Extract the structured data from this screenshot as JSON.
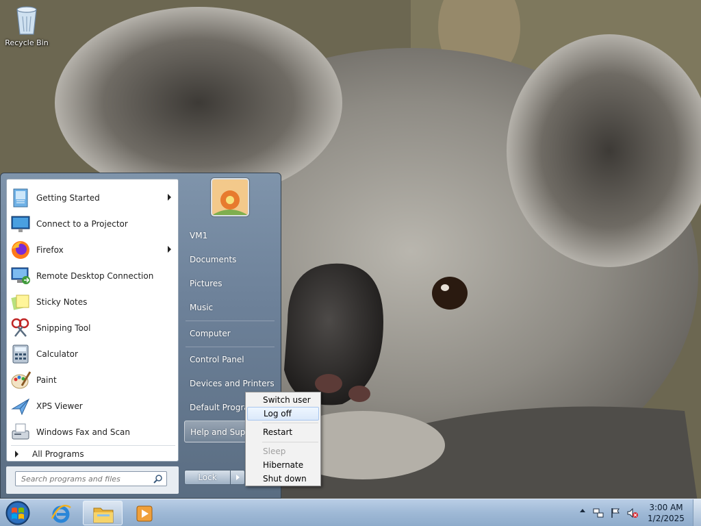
{
  "desktop": {
    "icons": [
      {
        "label": "Recycle Bin",
        "icon": "recycle-bin-icon"
      }
    ]
  },
  "start_menu": {
    "programs": [
      {
        "label": "Getting Started",
        "icon": "getting-started-icon",
        "submenu": true
      },
      {
        "label": "Connect to a Projector",
        "icon": "projector-icon",
        "submenu": false
      },
      {
        "label": "Firefox",
        "icon": "firefox-icon",
        "submenu": true
      },
      {
        "label": "Remote Desktop Connection",
        "icon": "remote-desktop-icon",
        "submenu": false
      },
      {
        "label": "Sticky Notes",
        "icon": "sticky-notes-icon",
        "submenu": false
      },
      {
        "label": "Snipping Tool",
        "icon": "snipping-tool-icon",
        "submenu": false
      },
      {
        "label": "Calculator",
        "icon": "calculator-icon",
        "submenu": false
      },
      {
        "label": "Paint",
        "icon": "paint-icon",
        "submenu": false
      },
      {
        "label": "XPS Viewer",
        "icon": "xps-viewer-icon",
        "submenu": false
      },
      {
        "label": "Windows Fax and Scan",
        "icon": "fax-scan-icon",
        "submenu": false
      }
    ],
    "all_programs": "All Programs",
    "search_placeholder": "Search programs and files",
    "right_links": [
      {
        "label": "VM1"
      },
      {
        "label": "Documents"
      },
      {
        "label": "Pictures"
      },
      {
        "label": "Music"
      },
      {
        "label": "Computer"
      },
      {
        "label": "Control Panel"
      },
      {
        "label": "Devices and Printers"
      },
      {
        "label": "Default Programs"
      },
      {
        "label": "Help and Support"
      }
    ],
    "lock_label": "Lock"
  },
  "power_menu": {
    "items": [
      "Switch user",
      "Log off",
      "Restart",
      "Sleep",
      "Hibernate",
      "Shut down"
    ],
    "highlighted": "Log off",
    "disabled": [
      "Sleep"
    ]
  },
  "taskbar": {
    "pinned": [
      "internet-explorer-icon",
      "windows-explorer-icon",
      "media-player-icon"
    ],
    "active": "windows-explorer-icon",
    "clock_time": "3:00 AM",
    "clock_date": "1/2/2025",
    "tray_icons": [
      "network-icon",
      "action-center-flag-icon",
      "volume-muted-icon"
    ]
  },
  "colors": {
    "start_menu_bg": "#6d8199",
    "taskbar_bg": "#9fb9d6",
    "highlight": "#dbe9fa"
  }
}
